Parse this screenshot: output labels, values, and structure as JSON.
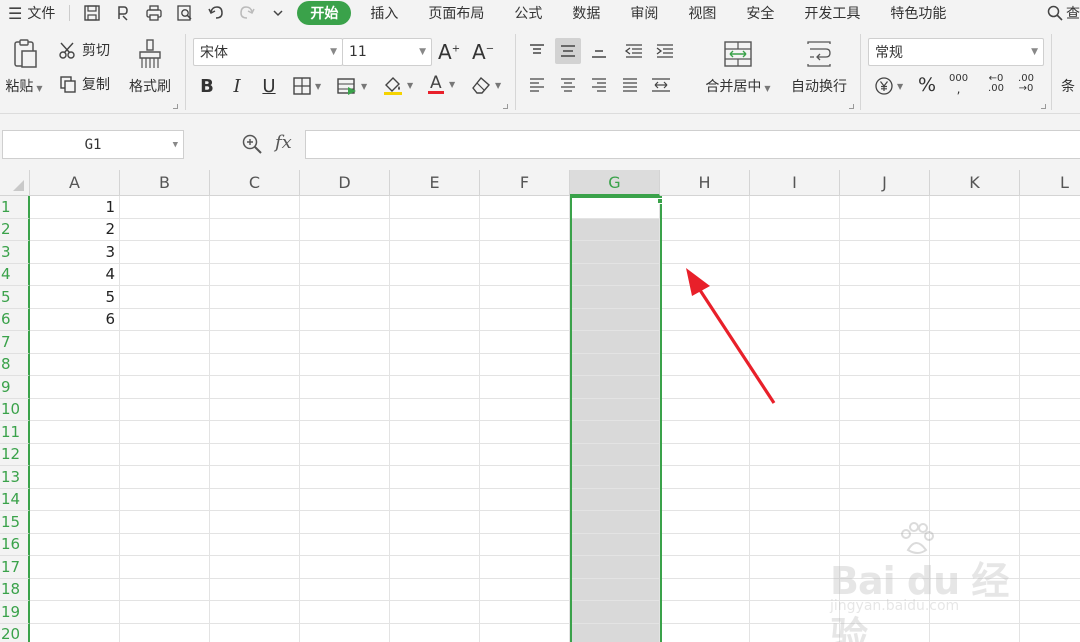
{
  "menubar": {
    "file_label": "文件",
    "tabs": [
      {
        "label": "开始",
        "active": true
      },
      {
        "label": "插入"
      },
      {
        "label": "页面布局"
      },
      {
        "label": "公式"
      },
      {
        "label": "数据"
      },
      {
        "label": "审阅"
      },
      {
        "label": "视图"
      },
      {
        "label": "安全"
      },
      {
        "label": "开发工具"
      },
      {
        "label": "特色功能"
      }
    ],
    "search_partial": "查"
  },
  "ribbon": {
    "paste_label": "粘贴",
    "cut_label": "剪切",
    "copy_label": "复制",
    "format_painter_label": "格式刷",
    "font_name": "宋体",
    "font_size": "11",
    "merge_center_label": "合并居中",
    "wrap_text_label": "自动换行",
    "number_format": "常规",
    "percent_symbol": "%",
    "thousands_symbol": "000",
    "inc_decimal_label": "←0 .00",
    "dec_decimal_label": ".00 →0",
    "conditional_partial": "条"
  },
  "formula_bar": {
    "name_box_value": "G1",
    "fx_label": "fx",
    "formula_value": ""
  },
  "sheet": {
    "columns": [
      "A",
      "B",
      "C",
      "D",
      "E",
      "F",
      "G",
      "H",
      "I",
      "J",
      "K",
      "L"
    ],
    "selected_column": "G",
    "rows": [
      "1",
      "2",
      "3",
      "4",
      "5",
      "6",
      "7",
      "8",
      "9",
      "10",
      "11",
      "12",
      "13",
      "14",
      "15",
      "16",
      "17",
      "18",
      "19",
      "20"
    ],
    "column_a_values": [
      "1",
      "2",
      "3",
      "4",
      "5",
      "6"
    ]
  },
  "watermark": {
    "brand": "Bai du 经验",
    "url": "jingyan.baidu.com"
  },
  "colors": {
    "accent": "#3aa24a",
    "selection": "#d9d9d9",
    "arrow": "#e8202a"
  }
}
